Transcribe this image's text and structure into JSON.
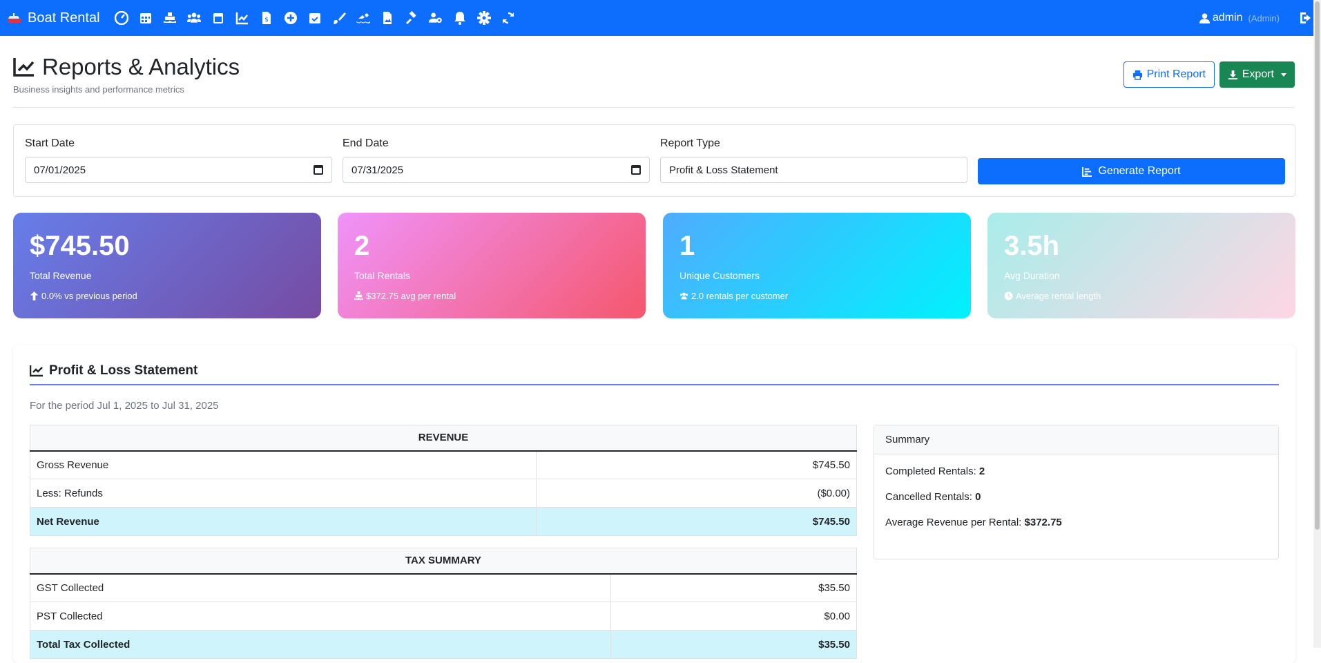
{
  "nav": {
    "brand": "Boat Rental",
    "icons": [
      "dashboard-icon",
      "calendar-icon",
      "boat-icon",
      "users-icon",
      "calendar-alt-icon",
      "chart-line-icon",
      "invoice-icon",
      "plus-circle-icon",
      "calendar-check-icon",
      "brush-icon",
      "swimmer-icon",
      "file-image-icon",
      "gavel-icon",
      "user-cog-icon",
      "bell-icon",
      "gear-icon",
      "sync-icon"
    ],
    "user": "admin",
    "role": "(Admin)"
  },
  "header": {
    "title": "Reports & Analytics",
    "subtitle": "Business insights and performance metrics",
    "print_label": "Print Report",
    "export_label": "Export"
  },
  "filters": {
    "start_label": "Start Date",
    "start_value": "07/01/2025",
    "end_label": "End Date",
    "end_value": "07/31/2025",
    "type_label": "Report Type",
    "type_value": "Profit & Loss Statement",
    "generate_label": "Generate Report"
  },
  "stats": [
    {
      "value": "$745.50",
      "label": "Total Revenue",
      "sub": "0.0% vs previous period",
      "icon": "arrow-up-icon"
    },
    {
      "value": "2",
      "label": "Total Rentals",
      "sub": "$372.75 avg per rental",
      "icon": "ship-icon"
    },
    {
      "value": "1",
      "label": "Unique Customers",
      "sub": "2.0 rentals per customer",
      "icon": "users-icon"
    },
    {
      "value": "3.5h",
      "label": "Avg Duration",
      "sub": "Average rental length",
      "icon": "clock-icon"
    }
  ],
  "report": {
    "title": "Profit & Loss Statement",
    "period": "For the period Jul 1, 2025 to Jul 31, 2025",
    "revenue": {
      "heading": "REVENUE",
      "rows": [
        {
          "label": "Gross Revenue",
          "amount": "$745.50"
        },
        {
          "label": "Less: Refunds",
          "amount": "($0.00)"
        },
        {
          "label": "Net Revenue",
          "amount": "$745.50"
        }
      ]
    },
    "tax": {
      "heading": "TAX SUMMARY",
      "rows": [
        {
          "label": "GST Collected",
          "amount": "$35.50"
        },
        {
          "label": "PST Collected",
          "amount": "$0.00"
        },
        {
          "label": "Total Tax Collected",
          "amount": "$35.50"
        }
      ]
    },
    "summary": {
      "heading": "Summary",
      "completed_label": "Completed Rentals:",
      "completed_value": "2",
      "cancelled_label": "Cancelled Rentals:",
      "cancelled_value": "0",
      "average_label": "Average Revenue per Rental:",
      "average_value": "$372.75"
    }
  },
  "colors": {
    "primary": "#0d6efd",
    "success": "#198754",
    "total_row": "#cff4fc",
    "accent_line": "#667eea"
  }
}
